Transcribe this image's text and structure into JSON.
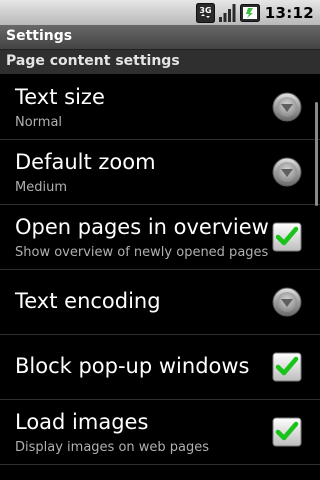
{
  "status_bar": {
    "network_label": "3G",
    "time": "13:12",
    "icons": [
      "3g-network-icon",
      "signal-strength-icon",
      "battery-icon"
    ]
  },
  "window": {
    "title": "Settings"
  },
  "section": {
    "title": "Page content settings"
  },
  "preferences": [
    {
      "title": "Text size",
      "summary": "Normal",
      "control": "dropdown",
      "checked": null
    },
    {
      "title": "Default zoom",
      "summary": "Medium",
      "control": "dropdown",
      "checked": null
    },
    {
      "title": "Open pages in overview",
      "summary": "Show overview of newly opened pages",
      "control": "checkbox",
      "checked": true
    },
    {
      "title": "Text encoding",
      "summary": "",
      "control": "dropdown",
      "checked": null
    },
    {
      "title": "Block pop-up windows",
      "summary": "",
      "control": "checkbox",
      "checked": true
    },
    {
      "title": "Load images",
      "summary": "Display images on web pages",
      "control": "checkbox",
      "checked": true
    }
  ],
  "colors": {
    "check_green": "#19c319",
    "dropdown_grey": "#8f8f8f"
  }
}
